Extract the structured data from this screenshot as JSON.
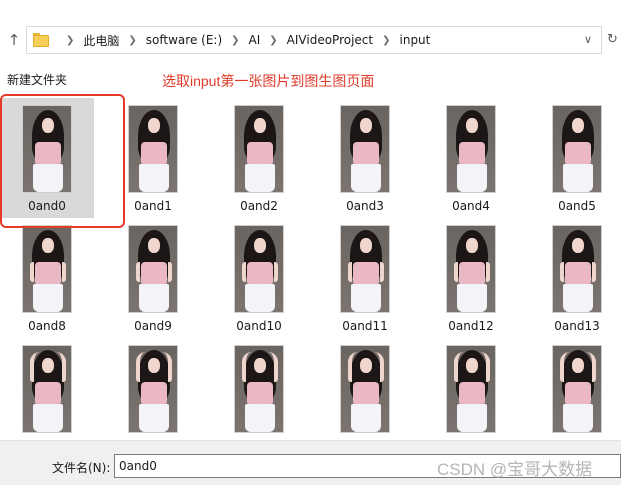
{
  "address_bar": {
    "crumbs": [
      "此电脑",
      "software (E:)",
      "AI",
      "AIVideoProject",
      "input"
    ]
  },
  "toolbar": {
    "new_folder_label": "新建文件夹"
  },
  "annotation": {
    "note_text": "选取input第一张图片到图生图页面",
    "note_color": "#e03b2a",
    "highlight_color": "#e53a2a"
  },
  "files": {
    "rows": [
      [
        "0and0",
        "0and1",
        "0and2",
        "0and3",
        "0and4",
        "0and5"
      ],
      [
        "0and8",
        "0and9",
        "0and10",
        "0and11",
        "0and12",
        "0and13"
      ],
      [
        "",
        "",
        "",
        "",
        "",
        ""
      ]
    ],
    "selected": "0and0"
  },
  "footer": {
    "filename_label": "文件名(N):",
    "filename_value": "0and0"
  },
  "watermark": "CSDN @宝哥大数据"
}
